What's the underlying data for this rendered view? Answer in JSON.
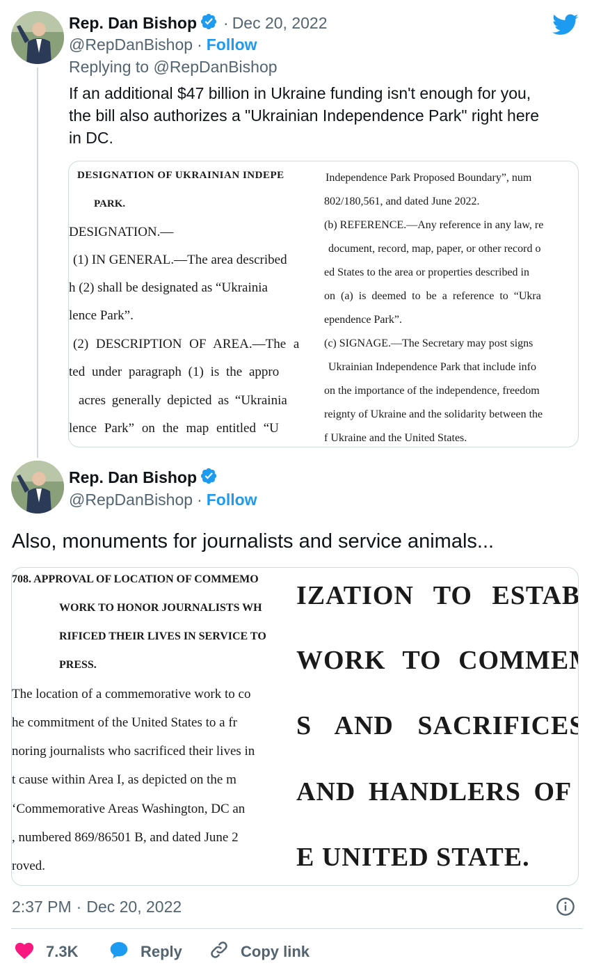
{
  "tweet1": {
    "name": "Rep. Dan Bishop",
    "handle": "@RepDanBishop",
    "date": "Dec 20, 2022",
    "date_sep": "·",
    "follow_sep": "·",
    "follow": "Follow",
    "replying_prefix": "Replying to ",
    "replying_handle": "@RepDanBishop",
    "text_lines": [
      "If an additional $47 billion in Ukraine funding isn't enough for you,",
      "the bill also authorizes a \"Ukrainian Independence Park\" right here",
      "in DC."
    ],
    "doc_left": [
      "DESIGNATION OF UKRAINIAN INDEPE",
      "PARK.",
      "DESIGNATION.—",
      "(1) IN GENERAL.—The area described",
      "h (2) shall be designated as “Ukrainia",
      "lence Park”.",
      "(2) DESCRIPTION OF AREA.—The a",
      "ted under paragraph (1) is the appro",
      "acres generally depicted as “Ukrainia",
      "lence Park” on the map entitled “U"
    ],
    "doc_right": [
      "Independence Park Proposed Boundary”, num",
      "802/180,561, and dated June 2022.",
      "(b) REFERENCE.—Any reference in any law, re",
      "document, record, map, paper, or other record o",
      "ed States to the area or properties described in",
      "on (a) is deemed to be a reference to “Ukra",
      "ependence Park”.",
      "(c) SIGNAGE.—The Secretary may post signs",
      "Ukrainian Independence Park that include info",
      "on the importance of the independence, freedom",
      "reignty of Ukraine and the solidarity between the",
      "f Ukraine and the United States."
    ]
  },
  "tweet2": {
    "name": "Rep. Dan Bishop",
    "handle": "@RepDanBishop",
    "follow_sep": "·",
    "follow": "Follow",
    "text": "Also, monuments for journalists and service animals...",
    "doc_left": [
      "708. APPROVAL OF LOCATION OF COMMEMO",
      "WORK TO HONOR JOURNALISTS WH",
      "RIFICED THEIR LIVES IN SERVICE TO",
      "PRESS.",
      "The location of a commemorative work to co",
      "he commitment of the United States to a fr",
      "noring journalists who sacrificed their lives in",
      "t cause within Area I, as depicted on the m",
      "‘Commemorative Areas Washington, DC an",
      ", numbered 869/86501 B, and dated June 2",
      "roved."
    ],
    "doc_right": [
      "IZATION TO ESTAB",
      "WORK TO COMMEMO",
      "S AND SACRIFICES",
      " AND HANDLERS OF",
      "E UNITED STATE."
    ]
  },
  "footer": {
    "time": "2:37 PM",
    "sep": "·",
    "date": "Dec 20, 2022",
    "likes": "7.3K",
    "reply": "Reply",
    "copy_link": "Copy link"
  },
  "colors": {
    "accent": "#1d9bf0",
    "like": "#f91880",
    "muted": "#536471",
    "border": "#cfd9de"
  },
  "icons": [
    "twitter-bird-icon",
    "verified-badge-icon",
    "info-icon",
    "heart-icon",
    "reply-bubble-icon",
    "link-icon"
  ]
}
